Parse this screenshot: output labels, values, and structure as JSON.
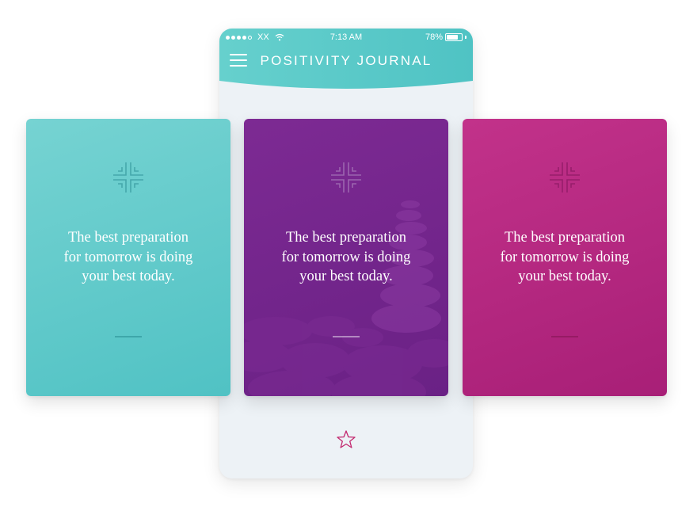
{
  "status_bar": {
    "carrier": "XX",
    "time": "7:13 AM",
    "battery": "78%",
    "battery_level": 0.78
  },
  "app": {
    "title": "POSITIVITY JOURNAL",
    "menu_icon": "hamburger-menu-icon",
    "favorite_icon": "star-outline-icon"
  },
  "colors": {
    "header_teal": "#5fcbc9",
    "teal_card": "#5ec8c9",
    "purple_card": "#72248a",
    "magenta_card": "#b4287f",
    "star_accent": "#c2286e"
  },
  "cards": [
    {
      "quote": "The best preparation\nfor tomorrow is doing\nyour best today.",
      "icon": "crosshair-mark-icon"
    },
    {
      "quote": "The best preparation\nfor tomorrow is doing\nyour best today.",
      "icon": "crosshair-mark-icon"
    },
    {
      "quote": "The best preparation\nfor tomorrow is doing\nyour best today.",
      "icon": "crosshair-mark-icon"
    }
  ]
}
